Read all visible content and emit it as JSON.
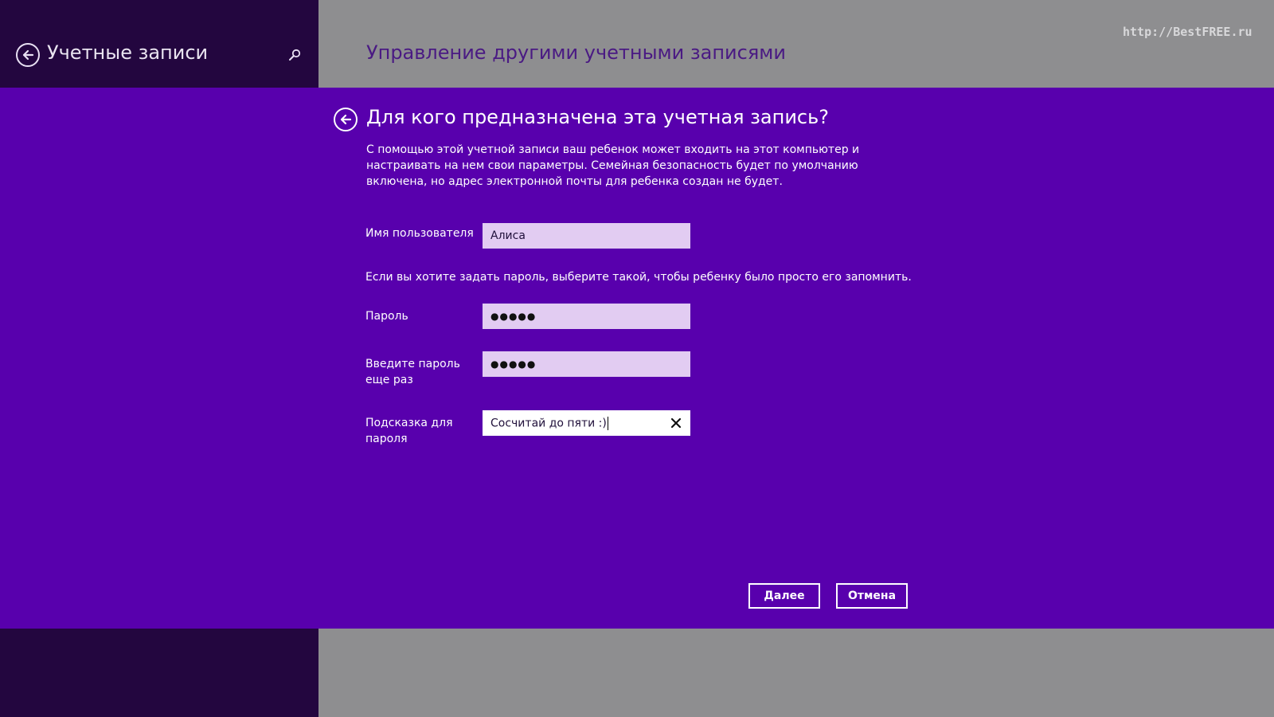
{
  "sidebar": {
    "title": "Учетные записи",
    "back_icon": "back-arrow-icon",
    "search_icon": "search-icon"
  },
  "header": {
    "title": "Управление другими учетными записями",
    "watermark": "http://BestFREE.ru"
  },
  "dialog": {
    "title": "Для кого предназначена эта учетная запись?",
    "description": "С помощью этой учетной записи ваш ребенок может входить на этот компьютер и настраивать на нем свои параметры. Семейная безопасность будет по умолчанию включена, но адрес электронной почты для ребенка создан не будет.",
    "username_label": "Имя пользователя",
    "username_value": "Алиса",
    "password_note": "Если вы хотите задать пароль, выберите такой, чтобы ребенку было просто его запомнить.",
    "password_label": "Пароль",
    "password_value": "●●●●●",
    "confirm_label": "Введите пароль еще раз",
    "confirm_value": "●●●●●",
    "hint_label": "Подсказка для пароля",
    "hint_value": "Сосчитай до пяти :)",
    "next_label": "Далее",
    "cancel_label": "Отмена"
  },
  "colors": {
    "dialog_background": "#5800ad",
    "sidebar_background": "#23063f",
    "header_background": "#8e8e90",
    "input_background": "#e2ccf2",
    "active_input_background": "#ffffff",
    "text": "#ffffff"
  }
}
